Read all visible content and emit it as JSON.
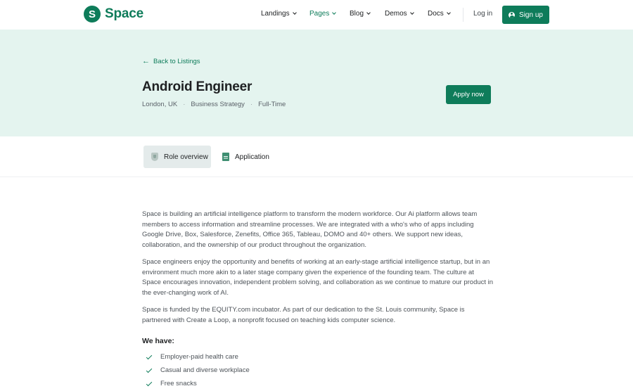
{
  "brand": {
    "logo_letter": "S",
    "name": "Space",
    "color": "#0e7c5a"
  },
  "nav": {
    "items": [
      {
        "label": "Landings",
        "active": false
      },
      {
        "label": "Pages",
        "active": true
      },
      {
        "label": "Blog",
        "active": false
      },
      {
        "label": "Demos",
        "active": false
      },
      {
        "label": "Docs",
        "active": false
      }
    ],
    "login_label": "Log in",
    "signup_label": "Sign up"
  },
  "hero": {
    "back_label": "Back to Listings",
    "title": "Android Engineer",
    "meta": [
      "London, UK",
      "Business Strategy",
      "Full-Time"
    ],
    "apply_label": "Apply now",
    "background": "#e4f4ef"
  },
  "tabs": [
    {
      "label": "Role overview",
      "icon": "shield-icon",
      "active": true
    },
    {
      "label": "Application",
      "icon": "document-icon",
      "active": false
    }
  ],
  "content": {
    "paragraphs": [
      "Space is building an artificial intelligence platform to transform the modern workforce. Our Ai platform allows team members to access information and streamline processes. We are integrated with a who's who of apps including Google Drive, Box, Salesforce, Zenefits, Office 365, Tableau, DOMO and 40+ others. We support new ideas, collaboration, and the ownership of our product throughout the organization.",
      "Space engineers enjoy the opportunity and benefits of working at an early-stage artificial intelligence startup, but in an environment much more akin to a later stage company given the experience of the founding team. The culture at Space encourages innovation, independent problem solving, and collaboration as we continue to mature our product in the ever-changing work of AI.",
      "Space is funded by the EQUITY.com incubator. As part of our dedication to the St. Louis community, Space is partnered with Create a Loop, a nonprofit focused on teaching kids computer science."
    ],
    "we_have_title": "We have:",
    "perks": [
      "Employer-paid health care",
      "Casual and diverse workplace",
      "Free snacks"
    ]
  }
}
